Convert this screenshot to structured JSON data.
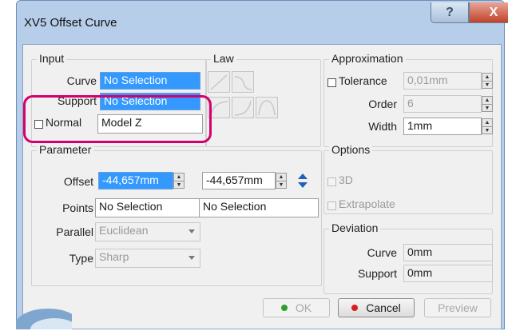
{
  "window": {
    "title": "XV5 Offset Curve",
    "help_icon": "?",
    "close_icon": "X"
  },
  "input": {
    "group_label": "Input",
    "curve_label": "Curve",
    "curve_value": "No Selection",
    "support_label": "Support",
    "support_value": "No Selection",
    "normal_label": "Normal",
    "normal_value": "Model Z"
  },
  "law": {
    "group_label": "Law"
  },
  "approximation": {
    "group_label": "Approximation",
    "tolerance_label": "Tolerance",
    "tolerance_value": "0,01mm",
    "order_label": "Order",
    "order_value": "6",
    "width_label": "Width",
    "width_value": "1mm"
  },
  "parameter": {
    "group_label": "Parameter",
    "offset_label": "Offset",
    "offset_value_1": "-44,657mm",
    "offset_value_2": "-44,657mm",
    "points_label": "Points",
    "points_value_1": "No Selection",
    "points_value_2": "No Selection",
    "parallel_label": "Parallel",
    "parallel_value": "Euclidean",
    "type_label": "Type",
    "type_value": "Sharp"
  },
  "options": {
    "group_label": "Options",
    "opt_3d": "3D",
    "extrapolate": "Extrapolate"
  },
  "deviation": {
    "group_label": "Deviation",
    "curve_label": "Curve",
    "curve_value": "0mm",
    "support_label": "Support",
    "support_value": "0mm"
  },
  "buttons": {
    "ok": "OK",
    "cancel": "Cancel",
    "preview": "Preview"
  },
  "colors": {
    "selection": "#3399ff",
    "highlight": "#d4006e",
    "ok_dot": "#2e9e2e",
    "cancel_dot": "#d42020"
  }
}
